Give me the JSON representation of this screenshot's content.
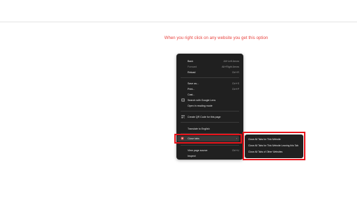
{
  "caption": "When you right click on any website you get this option",
  "menu": {
    "items": [
      {
        "label": "Back",
        "shortcut": "Alt+Left Arrow"
      },
      {
        "label": "Forward",
        "shortcut": "Alt+Right Arrow"
      },
      {
        "label": "Reload",
        "shortcut": "Ctrl+R"
      },
      {
        "label": "Save as...",
        "shortcut": "Ctrl+S"
      },
      {
        "label": "Print...",
        "shortcut": "Ctrl+P"
      },
      {
        "label": "Cast..."
      },
      {
        "label": "Search with Google Lens"
      },
      {
        "label": "Open in reading mode"
      },
      {
        "label": "Create QR Code for this page"
      },
      {
        "label": "Translate to English"
      },
      {
        "label": "Close tabs"
      },
      {
        "label": "View page source",
        "shortcut": "Ctrl+U"
      },
      {
        "label": "Inspect"
      }
    ]
  },
  "submenu": {
    "items": [
      {
        "label": "Close All Tabs for This Website"
      },
      {
        "label": "Close All Tabs for This Website Leaving this Tab"
      },
      {
        "label": "Close All Tabs of Other Websites"
      }
    ]
  },
  "icons": {
    "lens": "google-lens-icon",
    "qr": "qr-code-icon",
    "closetabs": "close-tabs-extension-icon",
    "arrow": "chevron-right-icon"
  },
  "colors": {
    "caption": "#e8403c",
    "highlight": "#e8141b",
    "menu_bg": "#202020"
  }
}
